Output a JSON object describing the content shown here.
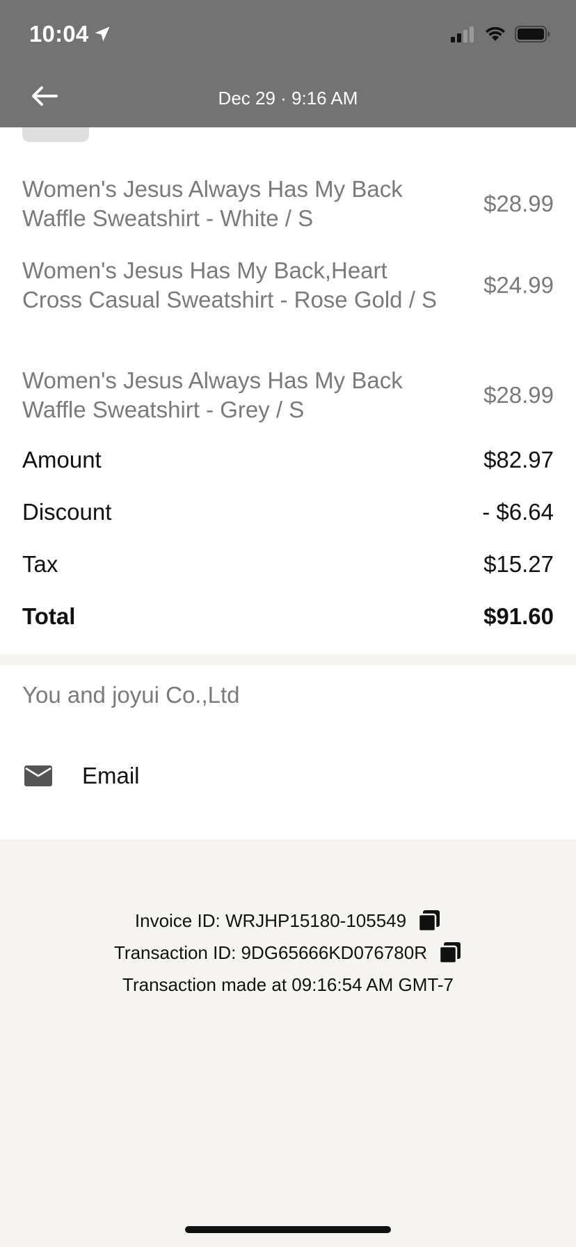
{
  "status_bar": {
    "time": "10:04"
  },
  "nav": {
    "title": "Dec 29 · 9:16 AM"
  },
  "items": [
    {
      "name": "Women's Jesus Always Has My Back Waffle Sweatshirt - White / S",
      "price": "$28.99"
    },
    {
      "name": "Women's Jesus Has My Back,Heart Cross  Casual Sweatshirt - Rose Gold / S",
      "price": "$24.99"
    },
    {
      "name": "Women's Jesus Always Has My Back Waffle Sweatshirt - Grey / S",
      "price": "$28.99"
    }
  ],
  "summary": {
    "amount_label": "Amount",
    "amount_value": "$82.97",
    "discount_label": "Discount",
    "discount_value": "- $6.64",
    "tax_label": "Tax",
    "tax_value": "$15.27",
    "total_label": "Total",
    "total_value": "$91.60"
  },
  "merchant": {
    "text": "You and joyui Co.,Ltd",
    "email_label": "Email"
  },
  "footer": {
    "invoice": "Invoice ID: WRJHP15180-105549",
    "transaction": "Transaction ID: 9DG65666KD076780R",
    "made_at": "Transaction made at 09:16:54 AM GMT-7"
  },
  "icons": {
    "back": "arrow-left-icon",
    "location": "location-arrow-icon",
    "signal": "signal-icon",
    "wifi": "wifi-icon",
    "battery": "battery-icon",
    "email": "envelope-icon",
    "copy": "copy-icon"
  },
  "colors": {
    "header_bg": "#737373",
    "muted_text": "#7a7a7a",
    "page_bg": "#f5f4f0"
  }
}
